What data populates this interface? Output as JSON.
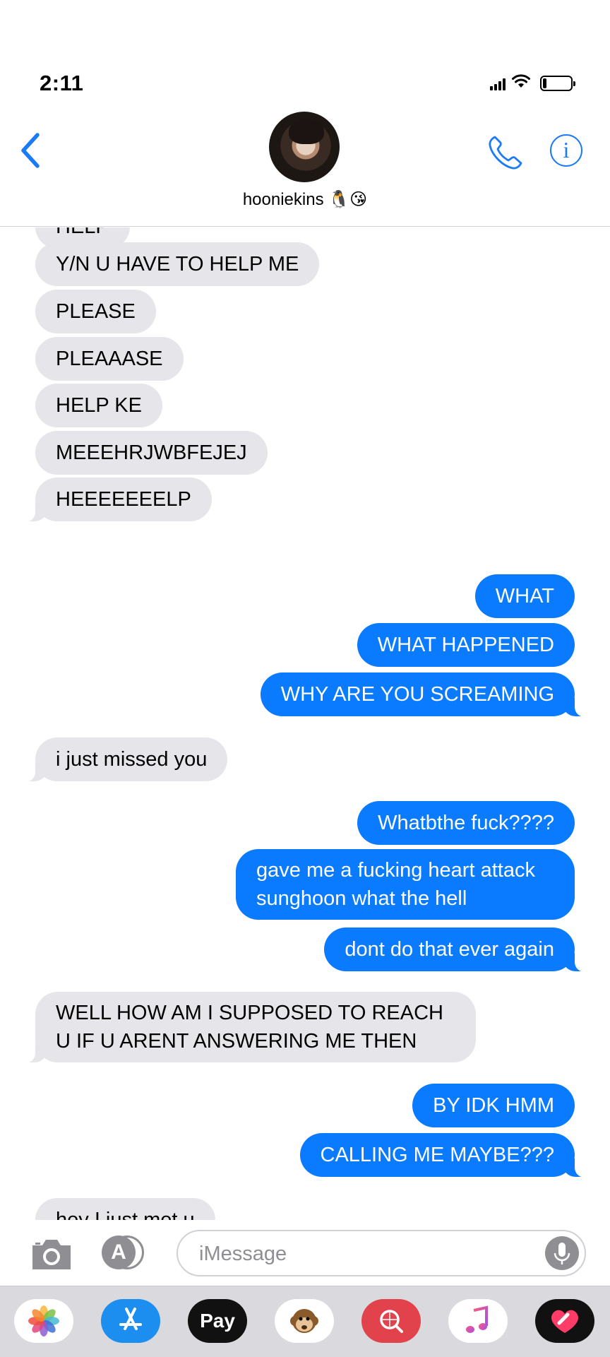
{
  "status_bar": {
    "time": "2:11"
  },
  "header": {
    "contact_name": "hooniekins",
    "contact_emojis": "🐧😘"
  },
  "messages": [
    {
      "from": "them",
      "text": "HELP"
    },
    {
      "from": "them",
      "text": "Y/N U HAVE TO HELP ME"
    },
    {
      "from": "them",
      "text": "PLEASE"
    },
    {
      "from": "them",
      "text": "PLEAAASE"
    },
    {
      "from": "them",
      "text": "HELP KE"
    },
    {
      "from": "them",
      "text": "MEEEHRJWBFEJEJ"
    },
    {
      "from": "them",
      "text": "HEEEEEEELP"
    },
    {
      "from": "me",
      "text": "WHAT"
    },
    {
      "from": "me",
      "text": "WHAT HAPPENED"
    },
    {
      "from": "me",
      "text": "WHY ARE YOU SCREAMING"
    },
    {
      "from": "them",
      "text": "i just missed you"
    },
    {
      "from": "me",
      "text": "Whatbthe fuck????"
    },
    {
      "from": "me",
      "text": "gave me a fucking heart attack sunghoon what the hell"
    },
    {
      "from": "me",
      "text": "dont do that ever again"
    },
    {
      "from": "them",
      "text": "WELL HOW AM I SUPPOSED TO REACH U IF U ARENT ANSWERING ME THEN"
    },
    {
      "from": "me",
      "text": "BY IDK HMM"
    },
    {
      "from": "me",
      "text": "CALLING ME MAYBE???"
    },
    {
      "from": "them",
      "text": "hey I just met u"
    }
  ],
  "input_bar": {
    "placeholder": "iMessage"
  },
  "app_drawer": {
    "apps": [
      "photos-icon",
      "app-store-icon",
      "apple-pay-icon",
      "animoji-icon",
      "image-search-icon",
      "music-icon",
      "digital-touch-icon"
    ],
    "apple_pay_label": "Pay"
  },
  "colors": {
    "accent": "#0a7aff",
    "incoming_bubble": "#e5e5ea",
    "drawer_bg": "#d9d9de"
  }
}
